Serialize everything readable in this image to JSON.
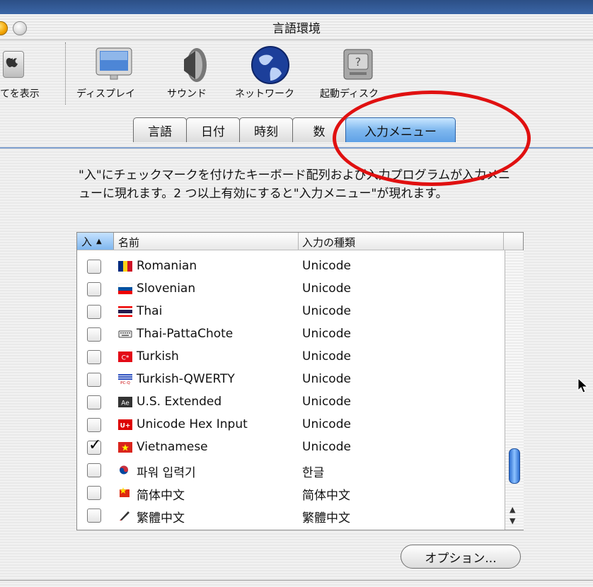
{
  "window": {
    "title": "言語環境"
  },
  "toolbar": {
    "items": [
      {
        "label": "てを表示",
        "icon": "apple-menu-icon"
      },
      {
        "label": "ディスプレイ",
        "icon": "display-icon"
      },
      {
        "label": "サウンド",
        "icon": "speaker-icon"
      },
      {
        "label": "ネットワーク",
        "icon": "globe-icon"
      },
      {
        "label": "起動ディスク",
        "icon": "hard-disk-icon"
      }
    ]
  },
  "tabs": [
    "言語",
    "日付",
    "時刻",
    "数",
    "入力メニュー"
  ],
  "active_tab": "入力メニュー",
  "description": "\"入\"にチェックマークを付けたキーボード配列および入力プログラムが入力メニューに現れます。2 つ以上有効にすると\"入力メニュー\"が現れます。",
  "table": {
    "headers": {
      "check": "入",
      "sort_indicator": "▲",
      "name": "名前",
      "type": "入力の種類"
    },
    "rows": [
      {
        "name": "Romanian",
        "type": "Unicode",
        "checked": false,
        "icon": "romania-flag-icon"
      },
      {
        "name": "Slovenian",
        "type": "Unicode",
        "checked": false,
        "icon": "slovenia-flag-icon"
      },
      {
        "name": "Thai",
        "type": "Unicode",
        "checked": false,
        "icon": "thailand-flag-icon"
      },
      {
        "name": "Thai-PattaChote",
        "type": "Unicode",
        "checked": false,
        "icon": "keyboard-icon"
      },
      {
        "name": "Turkish",
        "type": "Unicode",
        "checked": false,
        "icon": "turkey-flag-icon"
      },
      {
        "name": "Turkish-QWERTY",
        "type": "Unicode",
        "checked": false,
        "icon": "turkey-qwerty-icon"
      },
      {
        "name": "U.S. Extended",
        "type": "Unicode",
        "checked": false,
        "icon": "ae-icon"
      },
      {
        "name": "Unicode Hex Input",
        "type": "Unicode",
        "checked": false,
        "icon": "unicode-hex-icon"
      },
      {
        "name": "Vietnamese",
        "type": "Unicode",
        "checked": true,
        "icon": "vietnam-flag-icon"
      },
      {
        "name": "파워 입력기",
        "type": "한글",
        "checked": false,
        "icon": "korean-input-icon"
      },
      {
        "name": "简体中文",
        "type": "简体中文",
        "checked": false,
        "icon": "simplified-chinese-icon"
      },
      {
        "name": "繁體中文",
        "type": "繁體中文",
        "checked": false,
        "icon": "traditional-chinese-icon"
      }
    ]
  },
  "buttons": {
    "options": "オプション..."
  },
  "colors": {
    "accent": "#5fa1e6",
    "annotation": "#e01010"
  }
}
